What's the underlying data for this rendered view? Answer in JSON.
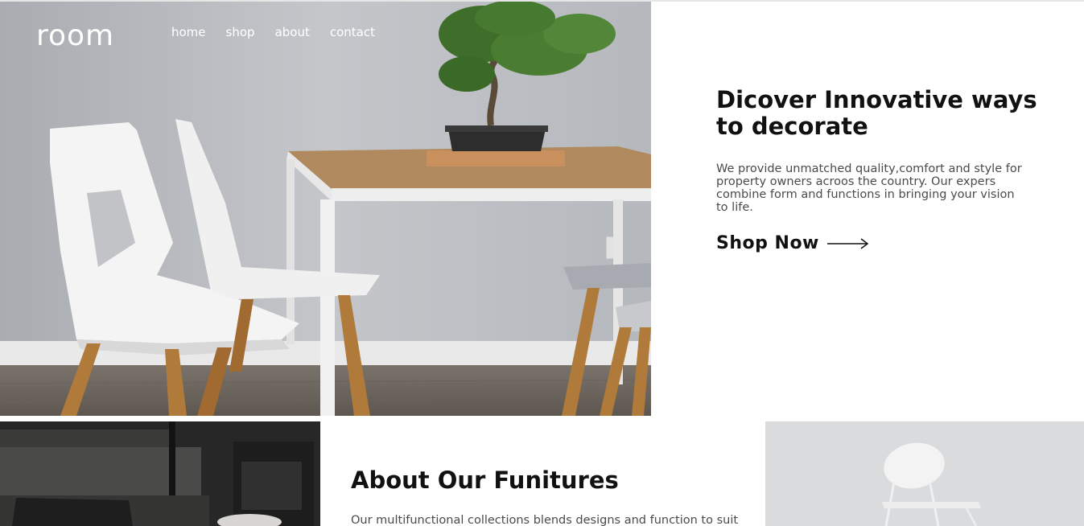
{
  "brand": {
    "logo": "room"
  },
  "nav": {
    "items": [
      "home",
      "shop",
      "about",
      "contact"
    ]
  },
  "hero": {
    "title": "Dicover Innovative ways to decorate",
    "description": "We provide unmatched quality,comfort and style for property owners acroos the country. Our expers combine form and functions in bringing your vision to life.",
    "cta_label": "Shop Now",
    "cta_icon": "arrow-right-icon"
  },
  "about": {
    "title": "About Our Funitures",
    "description": "Our multifunctional collections blends designs and function to suit"
  },
  "colors": {
    "text_dark": "#111111",
    "text_body": "#4a4a4a",
    "nav_text": "#ffffff",
    "wall_grey": "#b9bcc1",
    "table_wood": "#b08a5e"
  }
}
